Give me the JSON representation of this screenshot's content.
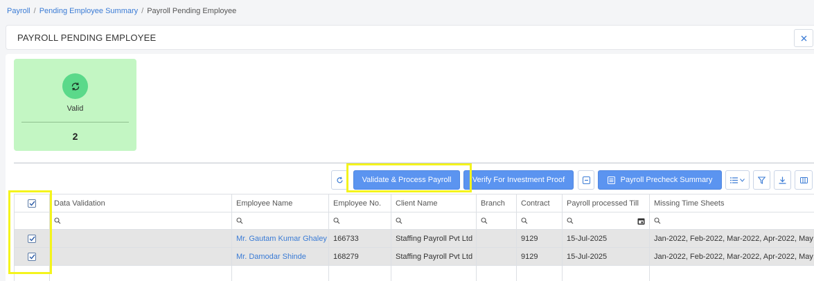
{
  "breadcrumb": {
    "items": [
      "Payroll",
      "Pending Employee Summary",
      "Payroll Pending Employee"
    ],
    "separator": "/"
  },
  "header": {
    "title": "PAYROLL PENDING EMPLOYEE",
    "close_icon": "close-icon"
  },
  "summary_card": {
    "label": "Valid",
    "count": "2",
    "icon": "sync-icon",
    "bg_color": "#c3f6c3",
    "icon_color": "#5bd98a"
  },
  "toolbar": {
    "validate_label": "Validate & Process Payroll",
    "verify_label": "Verify For Investment Proof",
    "precheck_label": "Payroll Precheck Summary",
    "icons": [
      "refresh-icon",
      "collapse-icon",
      "summary-icon",
      "column-chooser-icon",
      "filter-icon",
      "download-icon",
      "columns-icon"
    ]
  },
  "grid": {
    "columns": [
      "Data Validation",
      "Employee Name",
      "Employee No.",
      "Client Name",
      "Branch",
      "Contract",
      "Payroll processed Till",
      "Missing Time Sheets"
    ],
    "rows": [
      {
        "checked": true,
        "data_validation": "",
        "employee_name": "Mr. Gautam Kumar Ghaley",
        "employee_no": "166733",
        "client_name": "Staffing Payroll Pvt Ltd",
        "branch": "",
        "contract": "9129",
        "payroll_till": "15-Jul-2025",
        "missing_timesheets": "Jan-2022, Feb-2022, Mar-2022, Apr-2022, May"
      },
      {
        "checked": true,
        "data_validation": "",
        "employee_name": "Mr. Damodar Shinde",
        "employee_no": "168279",
        "client_name": "Staffing Payroll Pvt Ltd",
        "branch": "",
        "contract": "9129",
        "payroll_till": "15-Jul-2025",
        "missing_timesheets": "Jan-2022, Feb-2022, Mar-2022, Apr-2022, May"
      }
    ]
  },
  "colors": {
    "accent": "#5b94f0",
    "link": "#3a7bd5",
    "highlight": "#f4f41c",
    "row_bg": "#e5e5e5"
  }
}
